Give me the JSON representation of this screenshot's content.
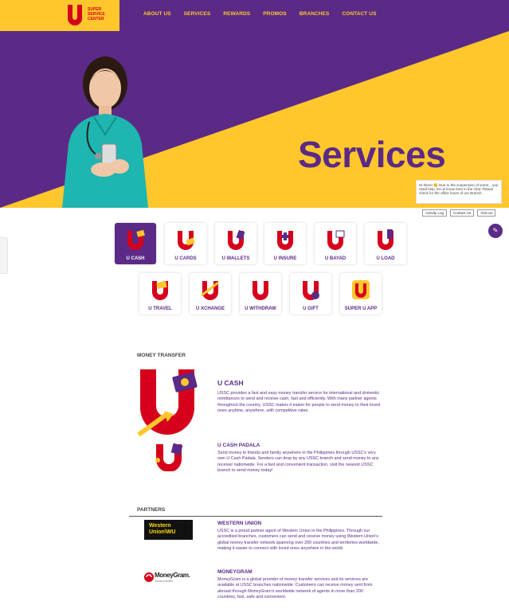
{
  "brand": {
    "logo_letter": "U",
    "logo_text_lines": [
      "SUPER",
      "SERVICE",
      "CENTER"
    ],
    "colors": {
      "purple": "#5b2a86",
      "yellow": "#ffc72c",
      "red": "#d6001c"
    }
  },
  "nav": {
    "items": [
      "ABOUT US",
      "SERVICES",
      "REWARDS",
      "PROMOS",
      "BRANCHES",
      "CONTACT US"
    ]
  },
  "hero": {
    "title": "Services",
    "notice": "Hi there! 😊 Due to the suspension of some... you need help, let us know here in the chat. Please check for the office hours of our Branch.",
    "mini_buttons": [
      "Activity Log",
      "Contact Us",
      "Visit Us"
    ]
  },
  "services": {
    "row1": [
      "U CASH",
      "U CARDS",
      "U WALLETS",
      "U INSURE",
      "U BAYAD",
      "U LOAD"
    ],
    "row2": [
      "U TRAVEL",
      "U XCHANGE",
      "U WITHDRAW",
      "U GIFT",
      "SUPER U APP"
    ],
    "active": "U CASH"
  },
  "money_transfer": {
    "heading": "MONEY TRANSFER",
    "ucash": {
      "title": "U CASH",
      "text": "USSC provides a fast and easy money transfer service for international and domestic remittances to send and receive cash, fast and efficiently. With many partner agents throughout the country, USSC makes it easier for people to send money to their loved ones anytime, anywhere, with competitive rates."
    },
    "ucash_padala": {
      "title": "U CASH PADALA",
      "text": "Send money to friends and family anywhere in the Philippines through USSC's very own U Cash Padala. Senders can drop by any USSC branch and send money to any receiver nationwide. For a fast and convenient transaction, visit the nearest USSC branch to send money today!"
    }
  },
  "partners": {
    "heading": "PARTNERS",
    "western_union": {
      "logo_lines": [
        "Western",
        "Union\\WU"
      ],
      "title": "WESTERN UNION",
      "text": "USSC is a proud partner agent of Western Union in the Philippines. Through our accredited branches, customers can send and receive money using Western Union's global money transfer network spanning over 200 countries and territories worldwide, making it easier to connect with loved ones anywhere in the world."
    },
    "moneygram": {
      "logo_text": "MoneyGram.",
      "logo_sub": "money transfer",
      "title": "MONEYGRAM",
      "text": "MoneyGram is a global provider of money transfer services and its services are available at USSC branches nationwide. Customers can receive money sent from abroad through MoneyGram's worldwide network of agents in more than 200 countries, fast, safe and convenient."
    }
  }
}
